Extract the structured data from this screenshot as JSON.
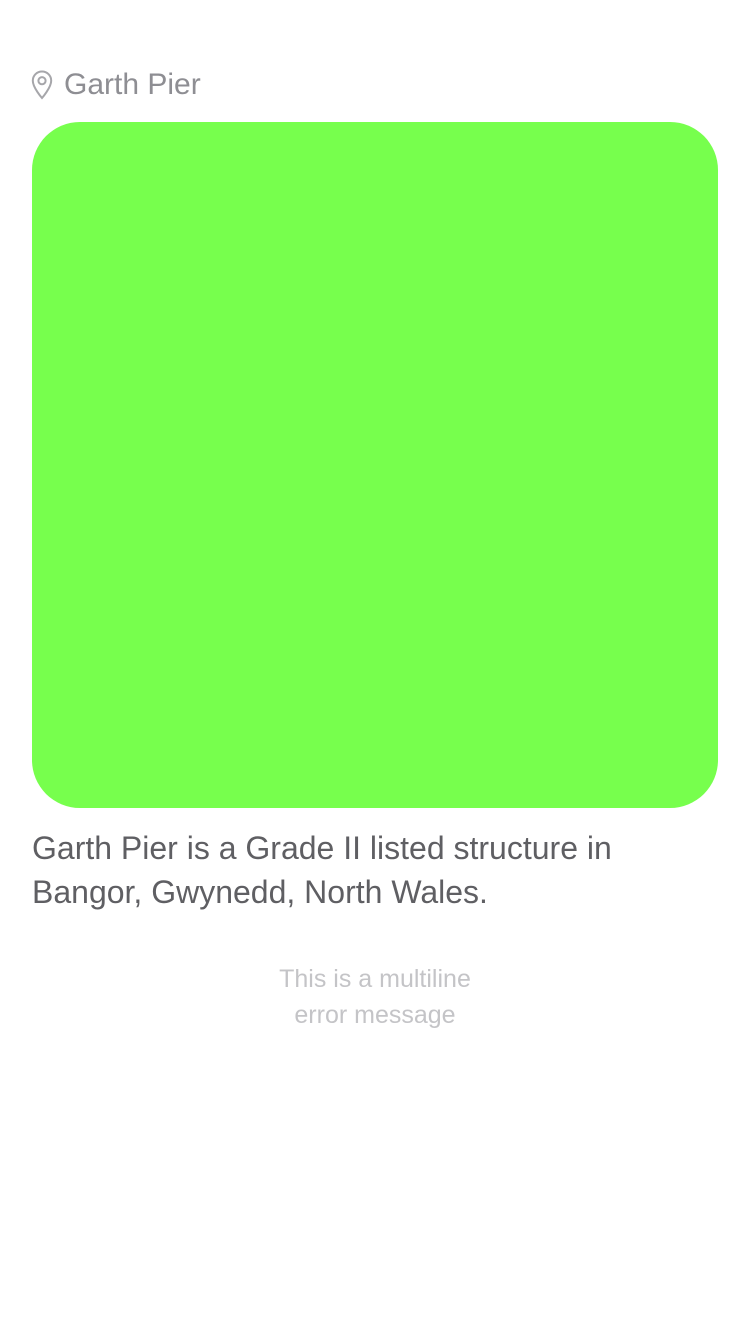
{
  "location": {
    "icon": "map-pin-icon",
    "name": "Garth Pier"
  },
  "image": {
    "color": "#77ff4d"
  },
  "description": "Garth Pier is a Grade II listed structure in Bangor, Gwynedd, North Wales.",
  "error": {
    "line1": "This is a multiline",
    "line2": "error message"
  }
}
